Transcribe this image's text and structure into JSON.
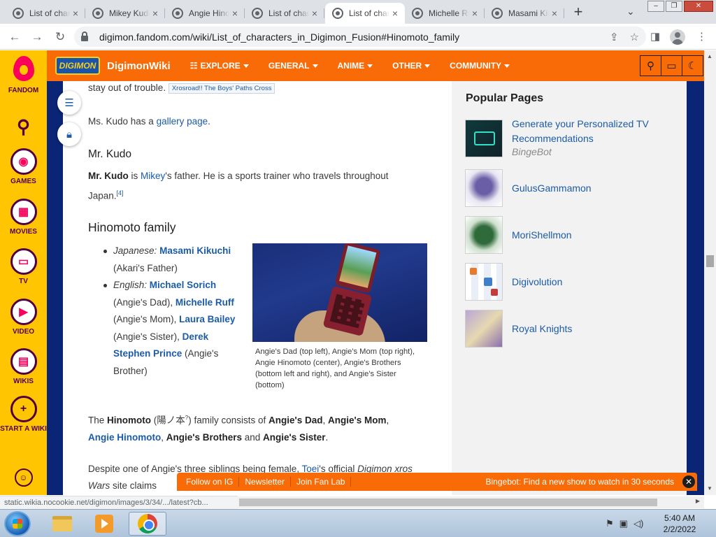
{
  "browser": {
    "tabs": [
      {
        "title": "List of characters in Digimon Fusion"
      },
      {
        "title": "Mikey Kudo"
      },
      {
        "title": "Angie Hinomoto"
      },
      {
        "title": "List of characters in Digimon Fusion"
      },
      {
        "title": "List of characters in Digimon Fusion",
        "active": true
      },
      {
        "title": "Michelle Ruff"
      },
      {
        "title": "Masami Kikuchi"
      }
    ],
    "url": "digimon.fandom.com/wiki/List_of_characters_in_Digimon_Fusion#Hinomoto_family",
    "status_url": "static.wikia.nocookie.net/digimon/images/3/34/.../latest?cb..."
  },
  "rail": {
    "logo_label": "FANDOM",
    "items": [
      {
        "label": "GAMES",
        "icon": "gamepad-icon"
      },
      {
        "label": "MOVIES",
        "icon": "film-icon"
      },
      {
        "label": "TV",
        "icon": "tv-icon"
      },
      {
        "label": "VIDEO",
        "icon": "play-icon"
      },
      {
        "label": "WIKIS",
        "icon": "book-icon"
      },
      {
        "label": "START A WIKI",
        "icon": "plus-icon"
      }
    ]
  },
  "wiki": {
    "logo_text": "DIGIMON",
    "name": "DigimonWiki",
    "nav": [
      {
        "label": "EXPLORE"
      },
      {
        "label": "GENERAL"
      },
      {
        "label": "ANIME"
      },
      {
        "label": "OTHER"
      },
      {
        "label": "COMMUNITY"
      }
    ]
  },
  "article": {
    "top_line": "stay out of trouble.",
    "top_cite": "Xrosroad!! The Boys' Paths Cross",
    "gallery_pre": "Ms. Kudo has a ",
    "gallery_link": "gallery page",
    "gallery_post": ".",
    "mr_kudo_heading": "Mr. Kudo",
    "mr_kudo_name": "Mr. Kudo",
    "mr_kudo_is": " is ",
    "mr_kudo_link": "Mikey",
    "mr_kudo_text": "'s father. He is a sports trainer who travels throughout Japan.",
    "mr_kudo_ref": "[4]",
    "section_heading": "Hinomoto family",
    "jp_label": "Japanese:",
    "jp_actor": "Masami Kikuchi",
    "jp_role": " (Akari's Father)",
    "en_label": "English:",
    "en_actor1": "Michael Sorich",
    "en_role1": " (Angie's Dad), ",
    "en_actor2": "Michelle Ruff",
    "en_role2": " (Angie's Mom), ",
    "en_actor3": "Laura Bailey",
    "en_role3": " (Angie's Sister), ",
    "en_actor4": "Derek Stephen Prince",
    "en_role4": " (Angie's Brother)",
    "caption": "Angie's Dad (top left), Angie's Mom (top right), Angie Hinomoto (center), Angie's Brothers (bottom left and right), and Angie's Sister (bottom)",
    "para1_a": "The ",
    "para1_b": "Hinomoto",
    "para1_c": " (陽ノ本",
    "para1_q": "?",
    "para1_d": ") family consists of ",
    "para1_e": "Angie's Dad",
    "para1_f": ", ",
    "para1_g": "Angie's Mom",
    "para1_h": ",",
    "para1_i": "Angie Hinomoto",
    "para1_j": ", ",
    "para1_k": "Angie's Brothers",
    "para1_l": " and ",
    "para1_m": "Angie's Sister",
    "para1_n": ".",
    "para2_a": "Despite one of Angie's three siblings being female, ",
    "para2_link": "Toei",
    "para2_b": "'s official ",
    "para2_i": "Digimon xros Wars",
    "para2_c": " site claims"
  },
  "popular": {
    "title": "Popular Pages",
    "items": [
      {
        "name": "Generate your Personalized TV Recommendations",
        "sub": "BingeBot"
      },
      {
        "name": "GulusGammamon"
      },
      {
        "name": "MoriShellmon"
      },
      {
        "name": "Digivolution"
      },
      {
        "name": "Royal Knights"
      }
    ]
  },
  "footer": {
    "links": [
      "Follow on IG",
      "Newsletter",
      "Join Fan Lab"
    ],
    "bingebot": "Bingebot: Find a new show to watch in 30 seconds"
  },
  "taskbar": {
    "time": "5:40 AM",
    "date": "2/2/2022"
  },
  "colors": {
    "fandom_yellow": "#ffc500",
    "wiki_orange": "#f96b06",
    "page_navy": "#0b2576",
    "link_blue": "#1b5ba8"
  }
}
